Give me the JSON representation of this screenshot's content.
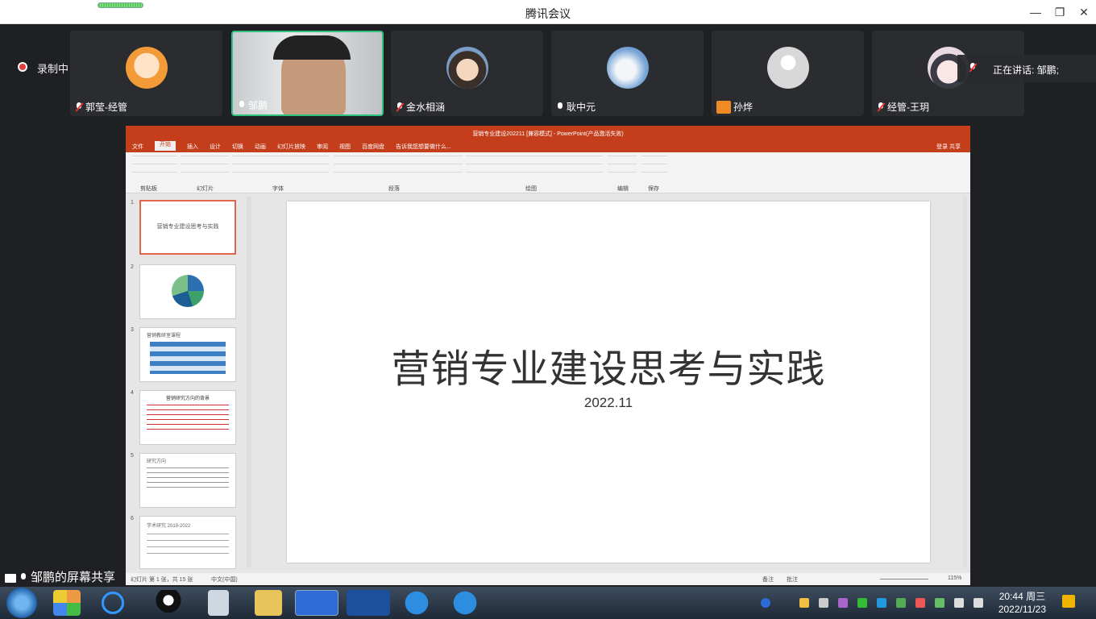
{
  "window": {
    "title": "腾讯会议"
  },
  "recording": {
    "label": "录制中"
  },
  "participants": [
    {
      "name": "郭莹-经管",
      "muted": true
    },
    {
      "name": "邹鹏",
      "muted": false
    },
    {
      "name": "金水相涵",
      "muted": true
    },
    {
      "name": "耿中元",
      "muted": false
    },
    {
      "name": "孙烨",
      "muted": false
    },
    {
      "name": "经管-王玥",
      "muted": true
    }
  ],
  "speaking": {
    "label": "正在讲话: 邹鹏;"
  },
  "ppt": {
    "doc_title": "营销专业建设202211 [兼容模式] - PowerPoint(产品激活失败)",
    "tabs": [
      "文件",
      "开始",
      "插入",
      "设计",
      "切换",
      "动画",
      "幻灯片放映",
      "审阅",
      "视图",
      "百度网盘",
      "告诉我您想要做什么..."
    ],
    "user": "登录  共享",
    "groups": [
      "剪贴板",
      "幻灯片",
      "字体",
      "段落",
      "绘图",
      "编辑",
      "保存"
    ],
    "thumbs": [
      {
        "num": "1",
        "text": "营销专业建设思考与实践"
      },
      {
        "num": "2",
        "text": ""
      },
      {
        "num": "3",
        "text": "营销教研室课程"
      },
      {
        "num": "4",
        "text": "营销研究方向的背景"
      },
      {
        "num": "5",
        "text": "研究方向"
      },
      {
        "num": "6",
        "text": "学术研究 2019-2022"
      }
    ],
    "slide_title": "营销专业建设思考与实践",
    "slide_date": "2022.11",
    "status_left": "幻灯片 第 1 张，共 15 张",
    "status_lang": "中文(中国)",
    "status_notes": "备注",
    "status_comments": "批注",
    "zoom": "115%"
  },
  "share_label": "邹鹏的屏幕共享",
  "taskbar": {
    "time": "20:44 周三",
    "date": "2022/11/23"
  }
}
